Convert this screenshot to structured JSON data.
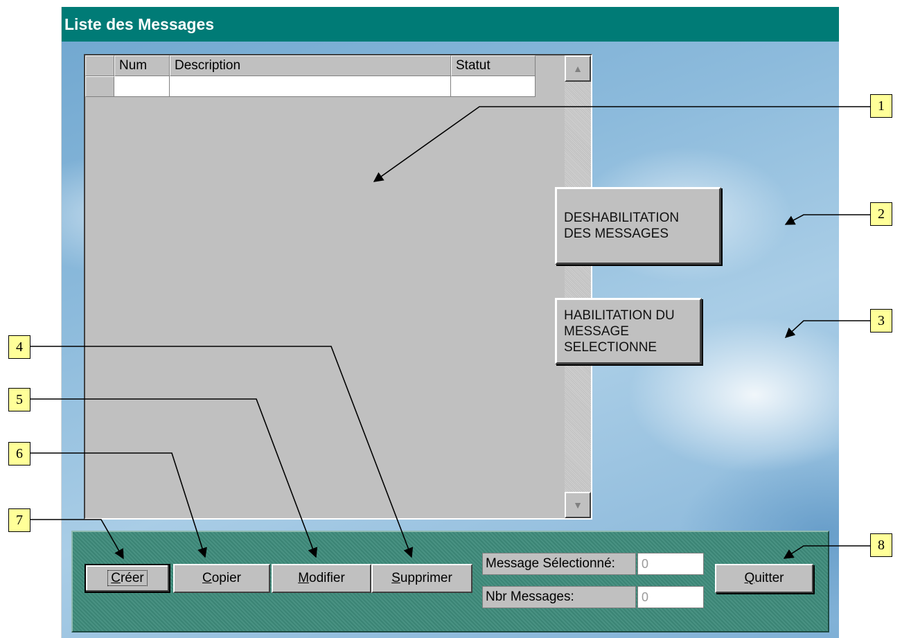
{
  "window": {
    "title": "Liste des Messages"
  },
  "grid": {
    "columns": [
      "Num",
      "Description",
      "Statut"
    ],
    "rows": [
      [
        "",
        "",
        ""
      ]
    ]
  },
  "side_buttons": {
    "deshabilitation_line1": "DESHABILITATION",
    "deshabilitation_line2": "DES MESSAGES",
    "habilitation_line1": "HABILITATION DU",
    "habilitation_line2": "MESSAGE",
    "habilitation_line3": "SELECTIONNE"
  },
  "toolbar": {
    "creer": "Créer",
    "copier": "Copier",
    "modifier": "Modifier",
    "supprimer": "Supprimer",
    "quitter": "Quitter"
  },
  "info": {
    "selected_label": "Message Sélectionné:",
    "selected_value": "0",
    "count_label": "Nbr Messages:",
    "count_value": "0"
  },
  "callouts": [
    "1",
    "2",
    "3",
    "4",
    "5",
    "6",
    "7",
    "8"
  ],
  "colors": {
    "titlebar": "#007b76",
    "callout_fill": "#ffff99",
    "panel": "#3f8c7c"
  }
}
